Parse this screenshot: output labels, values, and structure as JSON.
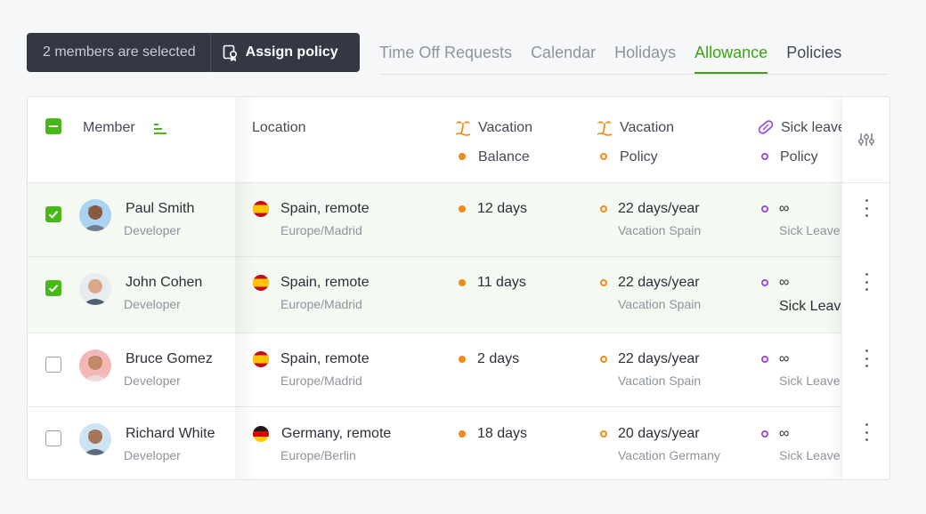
{
  "selection": {
    "text": "2 members are selected",
    "assign_label": "Assign policy"
  },
  "tabs": [
    {
      "label": "Time Off Requests",
      "active": false
    },
    {
      "label": "Calendar",
      "active": false
    },
    {
      "label": "Holidays",
      "active": false
    },
    {
      "label": "Allowance",
      "active": true
    },
    {
      "label": "Policies",
      "active": false
    }
  ],
  "table": {
    "headers": {
      "member": "Member",
      "location": "Location",
      "vacation_balance": {
        "line1": "Vacation",
        "line2": "Balance"
      },
      "vacation_policy": {
        "line1": "Vacation",
        "line2": "Policy"
      },
      "sick_leave_policy": {
        "line1": "Sick leave",
        "line2": "Policy"
      }
    },
    "rows": [
      {
        "selected": true,
        "name": "Paul Smith",
        "role": "Developer",
        "location": "Spain, remote",
        "timezone": "Europe/Madrid",
        "flag": "spain",
        "balance": "12 days",
        "vacation_policy": "22 days/year",
        "vacation_policy_name": "Vacation Spain",
        "sick_policy": "∞",
        "sick_policy_name": "Sick Leave Spain"
      },
      {
        "selected": true,
        "name": "John Cohen",
        "role": "Developer",
        "location": "Spain, remote",
        "timezone": "Europe/Madrid",
        "flag": "spain",
        "balance": "11 days",
        "vacation_policy": "22 days/year",
        "vacation_policy_name": "Vacation Spain",
        "sick_policy": "∞",
        "sick_policy_name": "Sick Leave Spain"
      },
      {
        "selected": false,
        "name": "Bruce Gomez",
        "role": "Developer",
        "location": "Spain, remote",
        "timezone": "Europe/Madrid",
        "flag": "spain",
        "balance": "2 days",
        "vacation_policy": "22 days/year",
        "vacation_policy_name": "Vacation Spain",
        "sick_policy": "∞",
        "sick_policy_name": "Sick Leave Spain"
      },
      {
        "selected": false,
        "name": "Richard White",
        "role": "Developer",
        "location": "Germany, remote",
        "timezone": "Europe/Berlin",
        "flag": "germany",
        "balance": "18 days",
        "vacation_policy": "20 days/year",
        "vacation_policy_name": "Vacation Germany",
        "sick_policy": "∞",
        "sick_policy_name": "Sick Leave Germany"
      }
    ]
  },
  "colors": {
    "accent_green": "#3aa50f",
    "checkbox_green": "#48b818",
    "vacation_orange": "#f08a18",
    "sick_purple": "#9b4be3",
    "selection_bar": "#343844"
  }
}
